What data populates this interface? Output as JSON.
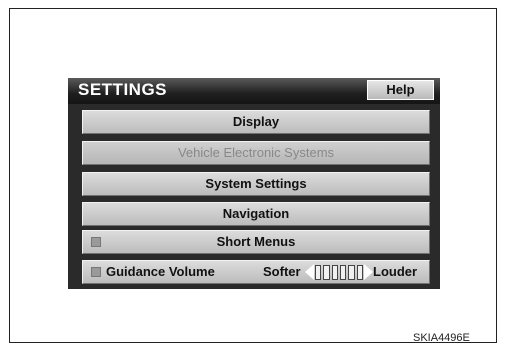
{
  "screen": {
    "title": "SETTINGS",
    "help_label": "Help"
  },
  "menu": {
    "display": "Display",
    "vehicle_electronic_systems": "Vehicle Electronic Systems",
    "system_settings": "System Settings",
    "navigation": "Navigation",
    "short_menus": "Short Menus"
  },
  "volume": {
    "label": "Guidance Volume",
    "softer": "Softer",
    "louder": "Louder",
    "level_steps_visible": 6
  },
  "figure_code": "SKIA4496E",
  "colors": {
    "screen_bg": "#2a2a2a",
    "button_face": "#cccccc",
    "disabled_text": "#888888"
  },
  "icons": {
    "checkbox": "square-checkbox-icon",
    "left_arrow": "triangle-left-icon",
    "right_arrow": "triangle-right-icon"
  }
}
